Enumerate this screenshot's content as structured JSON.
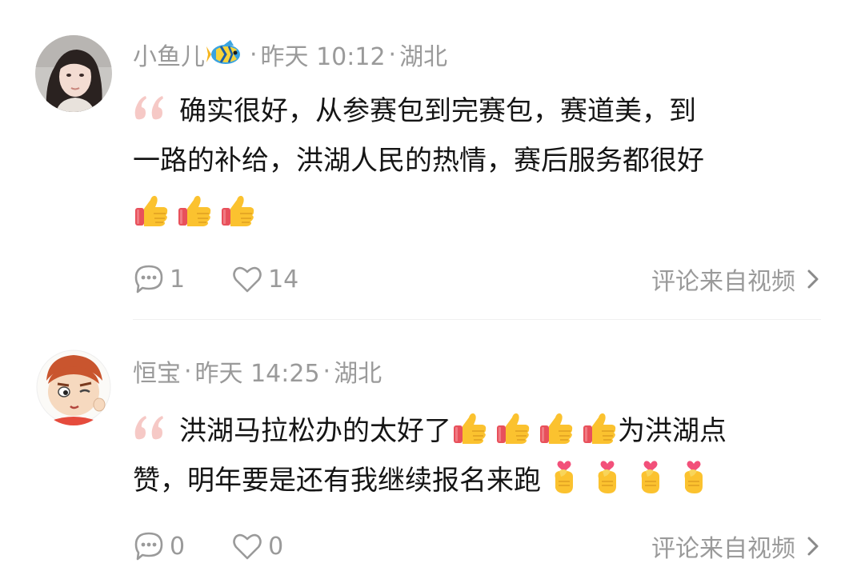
{
  "comments": [
    {
      "username": "小鱼儿",
      "time": "昨天 10:12",
      "location": "湖北",
      "text_lines": [
        "确实很好，从参赛包到完赛包，赛道美，到",
        "一路的补给，洪湖人民的热情，赛后服务都很好"
      ],
      "reply_count": "1",
      "like_count": "14",
      "source_label": "评论来自视频"
    },
    {
      "username": "恒宝",
      "time": "昨天 14:25",
      "location": "湖北",
      "text_part1": "洪湖马拉松办的太好了",
      "text_part2": "为洪湖点",
      "text_line2": "赞，明年要是还有我继续报名来跑",
      "reply_count": "0",
      "like_count": "0",
      "source_label": "评论来自视频"
    }
  ],
  "separator": "·",
  "icons": {
    "thumbs_up": "thumbs-up-emoji",
    "finger_heart": "finger-heart-emoji",
    "comment": "comment-bubble-icon",
    "like": "heart-icon",
    "chevron": "chevron-right-icon",
    "fish": "tropical-fish-emoji"
  },
  "colors": {
    "meta_gray": "#9a9a9a",
    "quote_pink": "#f6c9c6",
    "thumb_yellow": "#fbc22f",
    "cuff_red": "#e8505b"
  }
}
